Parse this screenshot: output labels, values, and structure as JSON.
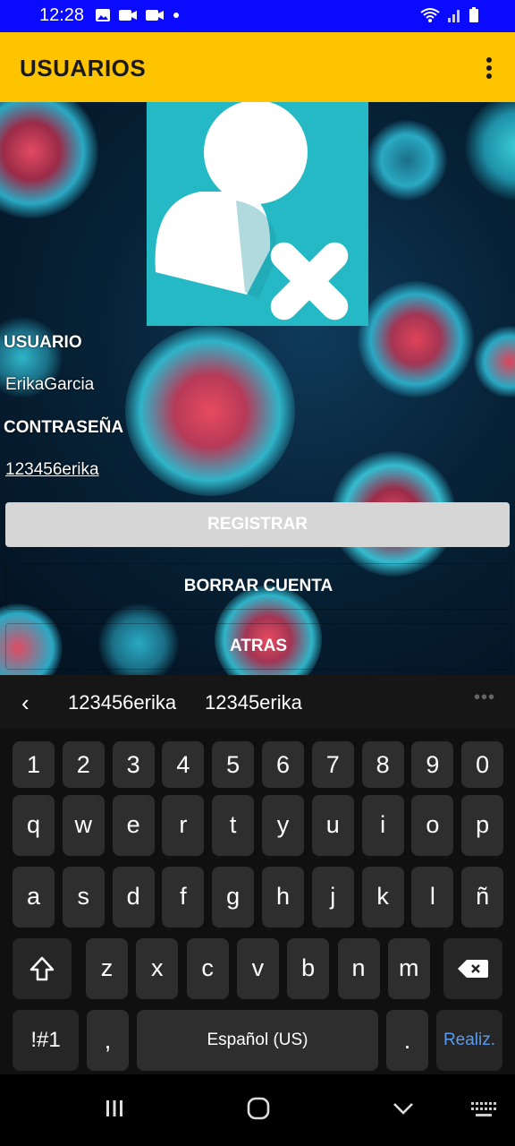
{
  "status_bar": {
    "time": "12:28",
    "icons_left": [
      "gallery-icon",
      "video-call-icon",
      "video-call-icon",
      "dot-icon"
    ],
    "icons_right": [
      "wifi-icon",
      "signal-icon",
      "battery-icon"
    ]
  },
  "app_bar": {
    "title": "USUARIOS",
    "menu_icon": "more-vert-icon",
    "background": "#ffc400"
  },
  "form": {
    "avatar_icon": "user-delete-icon",
    "usuario_label": "USUARIO",
    "usuario_value": "ErikaGarcia",
    "password_label": "CONTRASEÑA",
    "password_value": "123456erika",
    "buttons": {
      "registrar": "REGISTRAR",
      "borrar": "BORRAR CUENTA",
      "atras": "ATRAS"
    }
  },
  "keyboard": {
    "suggestions": [
      "123456erika",
      "12345erika"
    ],
    "back_icon": "chevron-left-icon",
    "more_icon": "more-horiz-icon",
    "rows": [
      [
        "1",
        "2",
        "3",
        "4",
        "5",
        "6",
        "7",
        "8",
        "9",
        "0"
      ],
      [
        "q",
        "w",
        "e",
        "r",
        "t",
        "y",
        "u",
        "i",
        "o",
        "p"
      ],
      [
        "a",
        "s",
        "d",
        "f",
        "g",
        "h",
        "j",
        "k",
        "l",
        "ñ"
      ],
      [
        "z",
        "x",
        "c",
        "v",
        "b",
        "n",
        "m"
      ]
    ],
    "shift_icon": "shift-icon",
    "backspace_icon": "backspace-icon",
    "symbols_label": "!#1",
    "comma_label": ",",
    "space_label": "Español (US)",
    "period_label": ".",
    "done_label": "Realiz.",
    "done_color": "#5a9bf0"
  },
  "nav_bar": {
    "buttons": [
      "recents-icon",
      "home-icon",
      "back-chevron-icon",
      "keyboard-icon"
    ]
  }
}
